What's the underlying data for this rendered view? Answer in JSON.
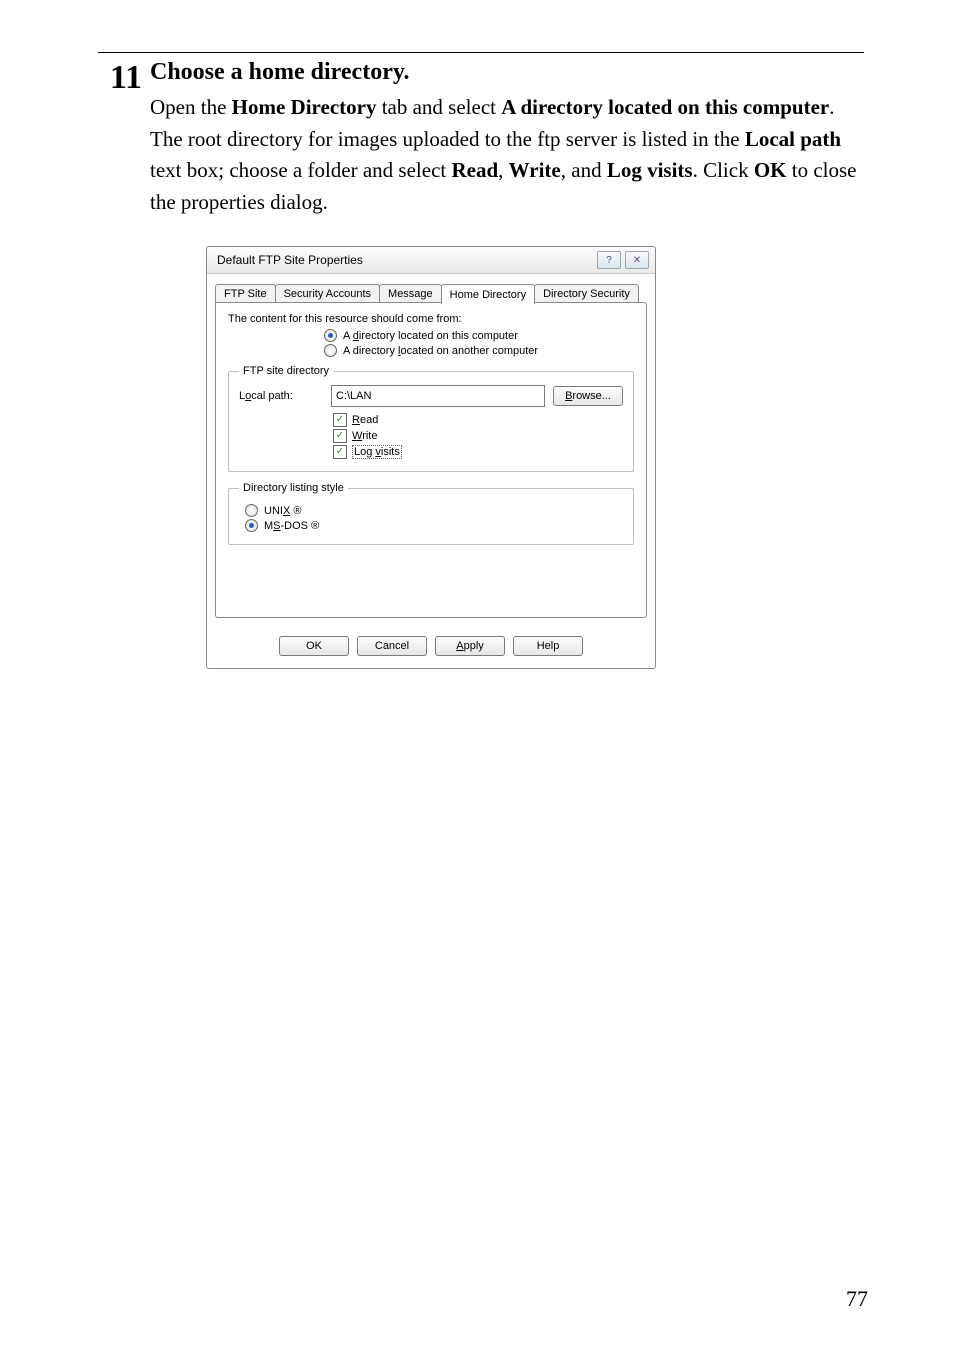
{
  "step": {
    "number": "11",
    "title": "Choose a home directory.",
    "text_parts": {
      "p1": "Open the ",
      "b1": "Home Directory",
      "p2": " tab and select ",
      "b2": "A directory located on this computer",
      "p3": ". The root directory for images uploaded to the ftp server is listed in the ",
      "b3": "Local path",
      "p4": " text box; choose a folder and select ",
      "b4": "Read",
      "p5": ", ",
      "b5": "Write",
      "p6": ", and ",
      "b6": "Log visits",
      "p7": ". Click ",
      "b7": "OK",
      "p8": " to close the properties dialog."
    }
  },
  "dialog": {
    "title": "Default FTP Site Properties",
    "help_icon": "?",
    "close_icon": "✕",
    "tabs": {
      "ftp_site": "FTP Site",
      "security_accounts": "Security Accounts",
      "message": "Message",
      "home_directory": "Home Directory",
      "directory_security": "Directory Security"
    },
    "panel": {
      "lead": "The content for this resource should come from:",
      "radio_this": "A directory located on this computer",
      "radio_other": "A directory located on another computer",
      "group1_legend": "FTP site directory",
      "local_path_label": "Local path:",
      "local_path_value": "C:\\LAN",
      "browse": "Browse...",
      "chk_read": "Read",
      "chk_write": "Write",
      "chk_log": "Log visits",
      "group2_legend": "Directory listing style",
      "unix": "UNIX ®",
      "msdos": "MS-DOS ®"
    },
    "buttons": {
      "ok": "OK",
      "cancel": "Cancel",
      "apply": "Apply",
      "help": "Help"
    }
  },
  "page_number": "77"
}
